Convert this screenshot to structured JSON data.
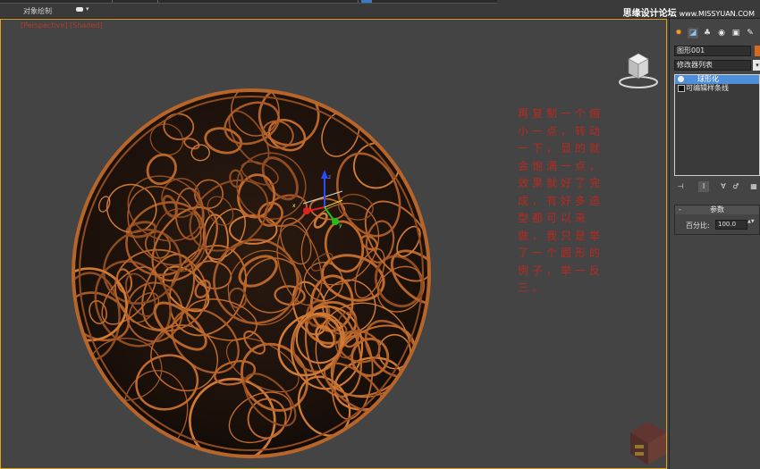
{
  "menu": {
    "object_paint_label": "对象绘制",
    "dropdown_caret": "▾"
  },
  "watermark": {
    "site_name": "思缘设计论坛",
    "site_url": "www.MISSYUAN.COM"
  },
  "viewport": {
    "label": "[Perspective] [Shaded]",
    "border_color": "#e0a020",
    "background_color": "#444444",
    "note_text": "再复制一个缩小一点，转动一下，显的就会饱满一点，效果就好了完成，有好多造型都可以来做，我只是举了一个圆形的例子，举一反三。",
    "note_color": "#b82a20",
    "wireframe_color": "#b8652a"
  },
  "command_panel": {
    "tabs": [
      {
        "icon": "sun-icon",
        "glyph": "✹"
      },
      {
        "icon": "modify-icon",
        "glyph": "◪"
      },
      {
        "icon": "hierarchy-icon",
        "glyph": "♣"
      },
      {
        "icon": "motion-icon",
        "glyph": "◉"
      },
      {
        "icon": "display-icon",
        "glyph": "▣"
      },
      {
        "icon": "utilities-icon",
        "glyph": "✎"
      }
    ],
    "object_name": "图形001",
    "object_color": "#d86a20",
    "modifier_list": "修改器列表",
    "modifier_list_arrow": "▾",
    "stack": [
      {
        "label": "球形化",
        "selected": true
      },
      {
        "label": "可编辑样条线",
        "selected": false
      }
    ],
    "stack_tools": [
      "⊣",
      "I",
      "∀",
      "♂",
      "▦"
    ],
    "rollout": {
      "title": "参数",
      "collapse": "-",
      "percent_label": "百分比:",
      "percent_value": "100.0",
      "spinner": "▲▼"
    }
  }
}
